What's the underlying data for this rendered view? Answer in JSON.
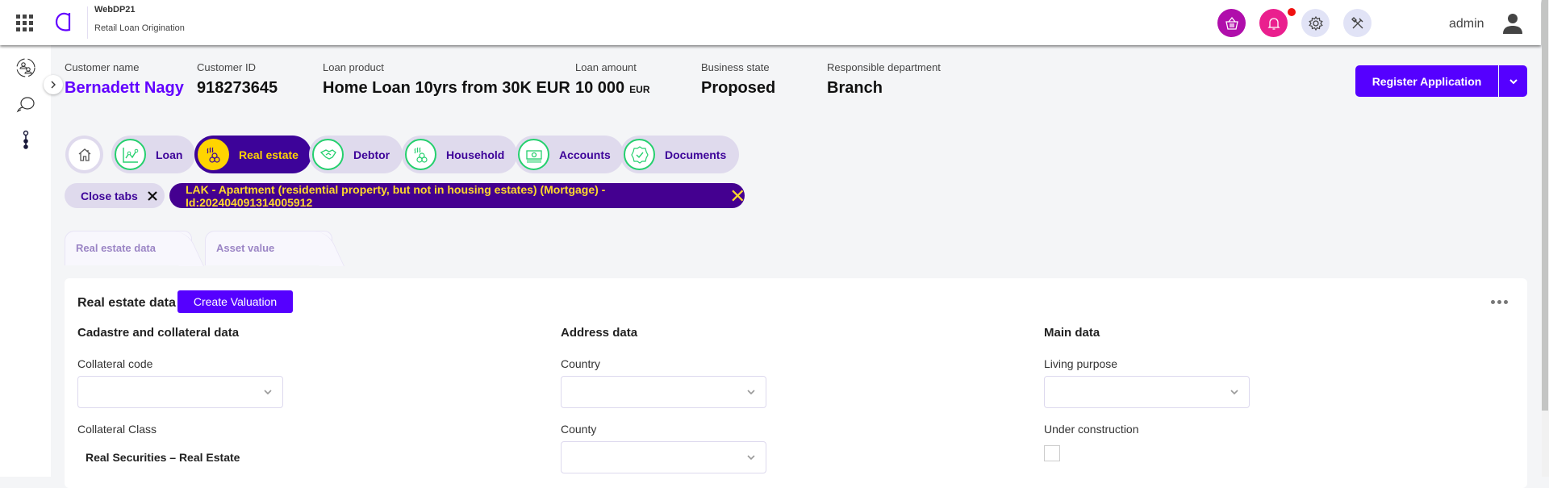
{
  "header": {
    "app_name": "WebDP21",
    "app_subtitle": "Retail Loan Origination",
    "user_name": "admin",
    "icons": [
      "apps-grid-icon",
      "brand-logo",
      "basket-icon",
      "bell-icon",
      "gear-icon",
      "tools-icon",
      "user-icon"
    ],
    "notification_dot": true,
    "colors": {
      "basket": "#b00eab",
      "bell": "#ea1f8e",
      "utility": "#e1e3f6",
      "brand": "#6200ff"
    }
  },
  "sidebar": {
    "icons": [
      "customer-exchange-icon",
      "chat-icon",
      "process-steps-icon"
    ]
  },
  "summary": {
    "customer_name_label": "Customer name",
    "customer_name": "Bernadett Nagy",
    "customer_id_label": "Customer ID",
    "customer_id": "918273645",
    "loan_product_label": "Loan product",
    "loan_product": "Home Loan 10yrs from 30K EUR",
    "loan_amount_label": "Loan amount",
    "loan_amount": "10 000",
    "loan_currency": "EUR",
    "business_state_label": "Business state",
    "business_state": "Proposed",
    "department_label": "Responsible department",
    "department": "Branch"
  },
  "actions": {
    "register_label": "Register Application",
    "primary_color": "#5500ff"
  },
  "nav_tabs": [
    {
      "label": "Loan",
      "icon": "chart-icon",
      "active": false
    },
    {
      "label": "Real estate",
      "icon": "real-estate-icon",
      "active": true
    },
    {
      "label": "Debtor",
      "icon": "handshake-icon",
      "active": false
    },
    {
      "label": "Household",
      "icon": "household-icon",
      "active": false
    },
    {
      "label": "Accounts",
      "icon": "banknote-icon",
      "active": false
    },
    {
      "label": "Documents",
      "icon": "badge-check-icon",
      "active": false
    }
  ],
  "open_tabs": {
    "close_label": "Close tabs",
    "record_label": "LAK - Apartment (residential property, but not in housing estates) (Mortgage) - Id:202404091314005912"
  },
  "sub_tabs": [
    {
      "label": "Real estate data",
      "active": true
    },
    {
      "label": "Asset value",
      "active": false
    }
  ],
  "card": {
    "title": "Real estate data",
    "create_valuation_label": "Create Valuation",
    "sections": {
      "cadastre": {
        "title": "Cadastre and collateral data",
        "collateral_code_label": "Collateral code",
        "collateral_code_value": "",
        "collateral_class_label": "Collateral Class",
        "collateral_class_value": "Real Securities – Real Estate"
      },
      "address": {
        "title": "Address data",
        "country_label": "Country",
        "country_value": "",
        "county_label": "County",
        "county_value": ""
      },
      "main": {
        "title": "Main data",
        "living_purpose_label": "Living purpose",
        "living_purpose_value": "",
        "under_construction_label": "Under construction",
        "under_construction_checked": false
      }
    }
  }
}
